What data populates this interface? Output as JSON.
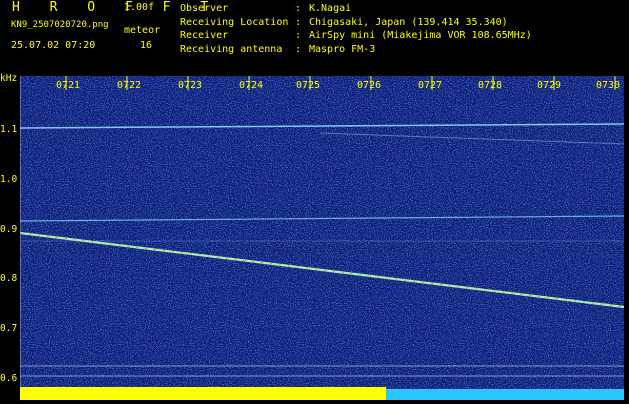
{
  "header": {
    "brand": "H R O F F T",
    "version": "1.00f",
    "filename": "KN9_2507020720.png",
    "datetime": "25.07.02 07:20",
    "meteor_label": "meteor",
    "meteor_value": "16"
  },
  "info": [
    {
      "key": "Observer",
      "sep": ":",
      "value": "K.Nagai"
    },
    {
      "key": "Receiving Location",
      "sep": ":",
      "value": "Chigasaki, Japan (139.414 35.340)"
    },
    {
      "key": "Receiver",
      "sep": ":",
      "value": "AirSpy mini (Miakejima VOR 108.65MHz)"
    },
    {
      "key": "Receiving antenna",
      "sep": ":",
      "value": "Maspro FM-3"
    }
  ],
  "colors": {
    "text": "#ffff00",
    "noise_bg": "#0a1a78",
    "trace": "#8fd8ff",
    "bar_yellow": "#ffff00",
    "bar_cyan": "#29c7ff"
  },
  "spectrogram": {
    "y_unit": "kHz",
    "y_ticks": [
      "1.1",
      "1.0",
      "0.9",
      "0.8",
      "0.7",
      "0.6"
    ],
    "x_ticks": [
      "0721",
      "0722",
      "0723",
      "0724",
      "0725",
      "0726",
      "0727",
      "0728",
      "0729",
      "0730"
    ]
  }
}
